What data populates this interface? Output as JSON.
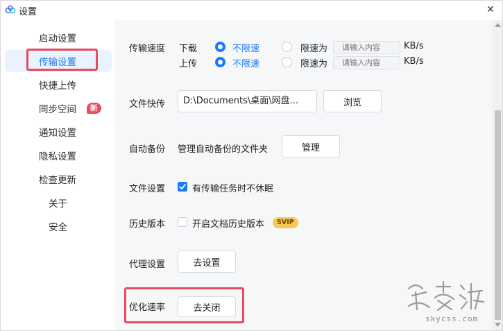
{
  "window": {
    "title": "设置",
    "close_glyph": "✕"
  },
  "sidebar": {
    "items": [
      {
        "label": "启动设置"
      },
      {
        "label": "传输设置",
        "active": true
      },
      {
        "label": "快捷上传"
      },
      {
        "label": "同步空间",
        "badge": "新"
      },
      {
        "label": "通知设置"
      },
      {
        "label": "隐私设置"
      },
      {
        "label": "检查更新"
      },
      {
        "label": "关于"
      },
      {
        "label": "安全"
      }
    ]
  },
  "transfer_speed": {
    "label": "传输速度",
    "download": {
      "label": "下载",
      "unlimited_label": "不限速",
      "limit_label": "限速为",
      "placeholder": "请输入内容",
      "unit": "KB/s",
      "selected": "unlimited"
    },
    "upload": {
      "label": "上传",
      "unlimited_label": "不限速",
      "limit_label": "限速为",
      "placeholder": "请输入内容",
      "unit": "KB/s",
      "selected": "unlimited"
    }
  },
  "file_quick": {
    "label": "文件快传",
    "path": "D:\\Documents\\桌面\\网盘...",
    "browse_button": "浏览"
  },
  "auto_backup": {
    "label": "自动备份",
    "description": "管理自动备份的文件夹",
    "manage_button": "管理"
  },
  "file_settings": {
    "label": "文件设置",
    "checkbox_label": "有传输任务时不休眠",
    "checked": true
  },
  "history_version": {
    "label": "历史版本",
    "checkbox_label": "开启文档历史版本",
    "checked": false,
    "badge": "SVIP"
  },
  "proxy": {
    "label": "代理设置",
    "button": "去设置"
  },
  "optimize_rate": {
    "label": "优化速率",
    "button": "去关闭"
  },
  "watermark": {
    "url": "skycss.com"
  },
  "colors": {
    "accent": "#1677ff",
    "highlight": "#e74a5e",
    "badge_red": "#f04a5f",
    "svip_gold": "#f7c75a",
    "panel_bg": "#f6f7f9"
  }
}
